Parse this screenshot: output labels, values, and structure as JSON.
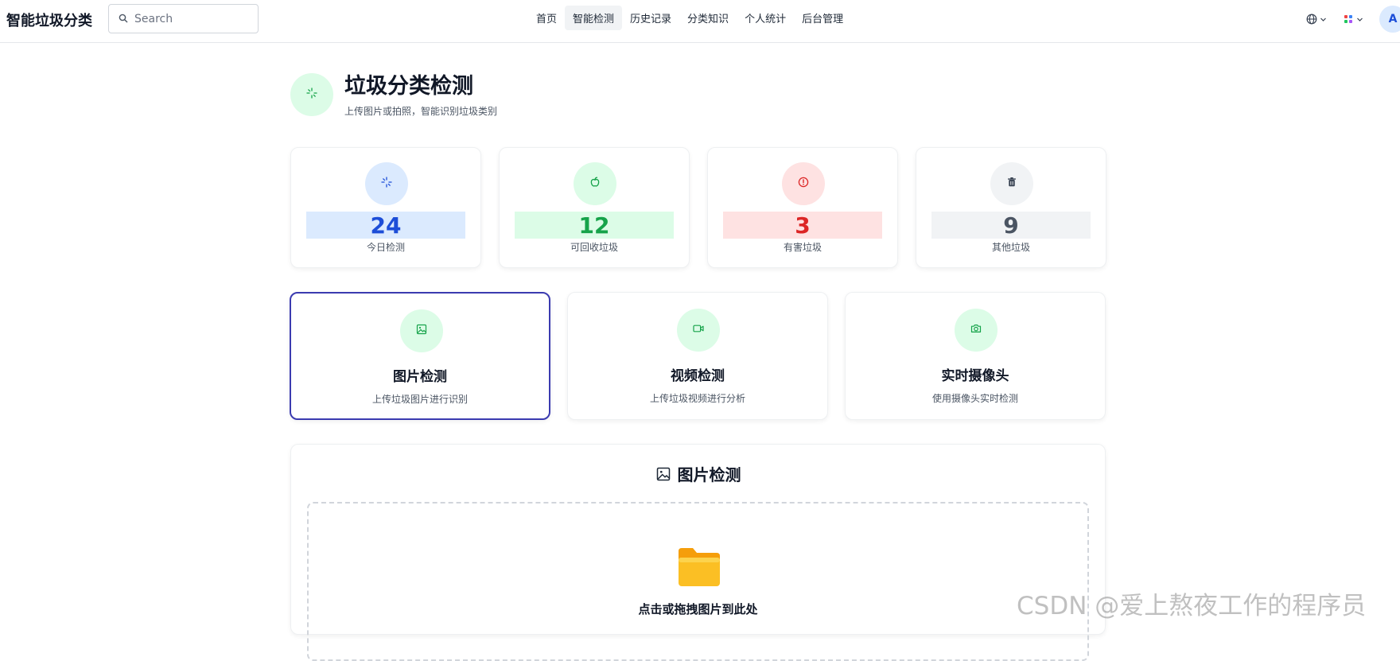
{
  "app": {
    "title": "智能垃圾分类"
  },
  "search": {
    "placeholder": "Search"
  },
  "nav": {
    "items": [
      {
        "label": "首页"
      },
      {
        "label": "智能检测"
      },
      {
        "label": "历史记录"
      },
      {
        "label": "分类知识"
      },
      {
        "label": "个人统计"
      },
      {
        "label": "后台管理"
      }
    ],
    "active_index": 1
  },
  "user": {
    "avatar_initial": "A"
  },
  "header": {
    "title": "垃圾分类检测",
    "subtitle": "上传图片或拍照，智能识别垃圾类别",
    "icon": "sparkle-icon"
  },
  "stats": [
    {
      "value": "24",
      "label": "今日检测",
      "icon": "sparkle-icon",
      "color": "#1d4ed8",
      "bg": "#dbeafe"
    },
    {
      "value": "12",
      "label": "可回收垃圾",
      "icon": "apple-icon",
      "color": "#16a34a",
      "bg": "#dcfce7"
    },
    {
      "value": "3",
      "label": "有害垃圾",
      "icon": "alert-icon",
      "color": "#dc2626",
      "bg": "#fee2e2"
    },
    {
      "value": "9",
      "label": "其他垃圾",
      "icon": "trash-icon",
      "color": "#4b5563",
      "bg": "#f1f3f5"
    }
  ],
  "modes": [
    {
      "title": "图片检测",
      "desc": "上传垃圾图片进行识别",
      "icon": "image-icon",
      "selected": true
    },
    {
      "title": "视频检测",
      "desc": "上传垃圾视频进行分析",
      "icon": "video-icon",
      "selected": false
    },
    {
      "title": "实时摄像头",
      "desc": "使用摄像头实时检测",
      "icon": "camera-icon",
      "selected": false
    }
  ],
  "panel": {
    "title": "图片检测",
    "drop_text": "点击或拖拽图片到此处"
  },
  "watermark": {
    "text": "CSDN @爱上熬夜工作的程序员"
  }
}
